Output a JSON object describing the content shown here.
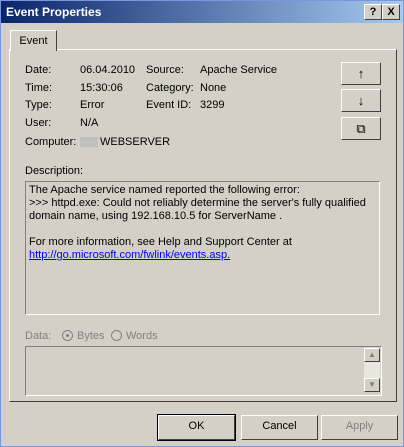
{
  "window": {
    "title": "Event Properties",
    "help_label": "?",
    "close_label": "X"
  },
  "tabs": [
    {
      "label": "Event"
    }
  ],
  "event": {
    "date_label": "Date:",
    "date": "06.04.2010",
    "time_label": "Time:",
    "time": "15:30:06",
    "type_label": "Type:",
    "type": "Error",
    "user_label": "User:",
    "user": "N/A",
    "computer_label": "Computer:",
    "computer": "WEBSERVER",
    "source_label": "Source:",
    "source": "Apache Service",
    "category_label": "Category:",
    "category": "None",
    "event_id_label": "Event ID:",
    "event_id": "3299"
  },
  "side_buttons": {
    "up": "↑",
    "down": "↓",
    "copy": "⧉"
  },
  "description": {
    "label": "Description:",
    "line1": "The Apache service named  reported the following error:",
    "line2": ">>> httpd.exe: Could not reliably determine the server's fully qualified",
    "line3": "domain name, using 192.168.10.5 for ServerName     .",
    "line4": "For more information, see Help and Support Center at",
    "link": "http://go.microsoft.com/fwlink/events.asp."
  },
  "data_section": {
    "label": "Data:",
    "bytes_label": "Bytes",
    "words_label": "Words",
    "selected": "Bytes"
  },
  "buttons": {
    "ok": "OK",
    "cancel": "Cancel",
    "apply": "Apply"
  }
}
